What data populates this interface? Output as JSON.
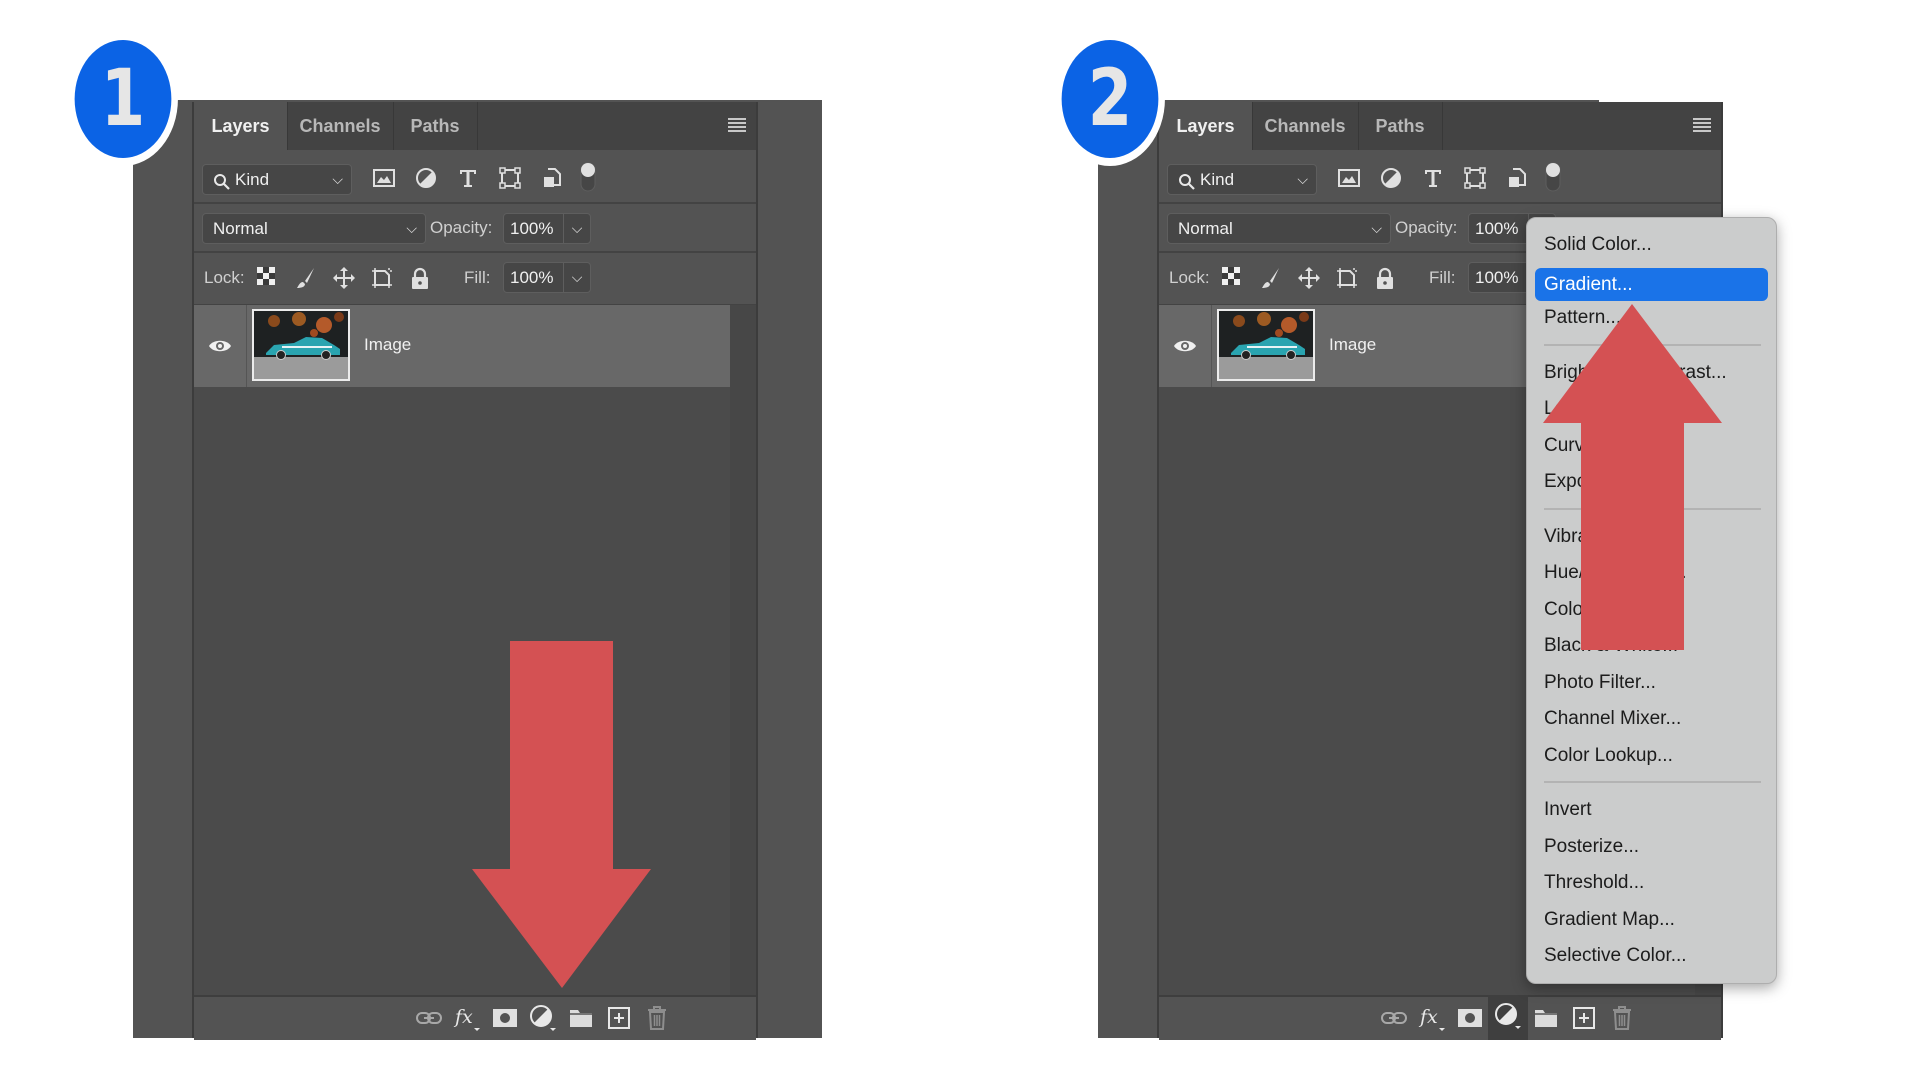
{
  "steps": [
    {
      "badge": "1",
      "tabs": [
        "Layers",
        "Channels",
        "Paths"
      ],
      "filter": {
        "kind_label": "Kind",
        "icons": [
          "image-filter-icon",
          "adjustment-filter-icon",
          "type-filter-icon",
          "shape-filter-icon",
          "smart-object-filter-icon"
        ]
      },
      "blend_mode": "Normal",
      "opacity_label": "Opacity:",
      "opacity_value": "100%",
      "lock_label": "Lock:",
      "fill_label": "Fill:",
      "fill_value": "100%",
      "layers": [
        {
          "name": "Image",
          "visible": true
        }
      ],
      "toolbar": [
        "link-layers",
        "add-layer-style",
        "add-mask",
        "new-fill-adjustment-layer",
        "new-group",
        "new-layer",
        "delete-layer"
      ],
      "annotation": "arrow pointing down to new fill/adjustment layer button"
    },
    {
      "badge": "2",
      "tabs": [
        "Layers",
        "Channels",
        "Paths"
      ],
      "filter": {
        "kind_label": "Kind"
      },
      "blend_mode": "Normal",
      "opacity_label": "Opacity:",
      "opacity_value": "100%",
      "lock_label": "Lock:",
      "fill_label": "Fill:",
      "fill_value": "100%",
      "layers": [
        {
          "name": "Image",
          "visible": true
        }
      ],
      "menu": {
        "highlighted": "Gradient...",
        "groups": [
          [
            "Solid Color...",
            "Gradient...",
            "Pattern..."
          ],
          [
            "Brightness/Contrast...",
            "Levels...",
            "Curves...",
            "Exposure..."
          ],
          [
            "Vibrance...",
            "Hue/Saturation...",
            "Color Balance...",
            "Black & White...",
            "Photo Filter...",
            "Channel Mixer...",
            "Color Lookup..."
          ],
          [
            "Invert",
            "Posterize...",
            "Threshold...",
            "Gradient Map...",
            "Selective Color..."
          ]
        ]
      },
      "annotation": "arrow pointing up to Gradient..."
    }
  ],
  "colors": {
    "badge": "#0b63e5",
    "arrow": "#d45153",
    "menu_highlight": "#1a73e8"
  }
}
